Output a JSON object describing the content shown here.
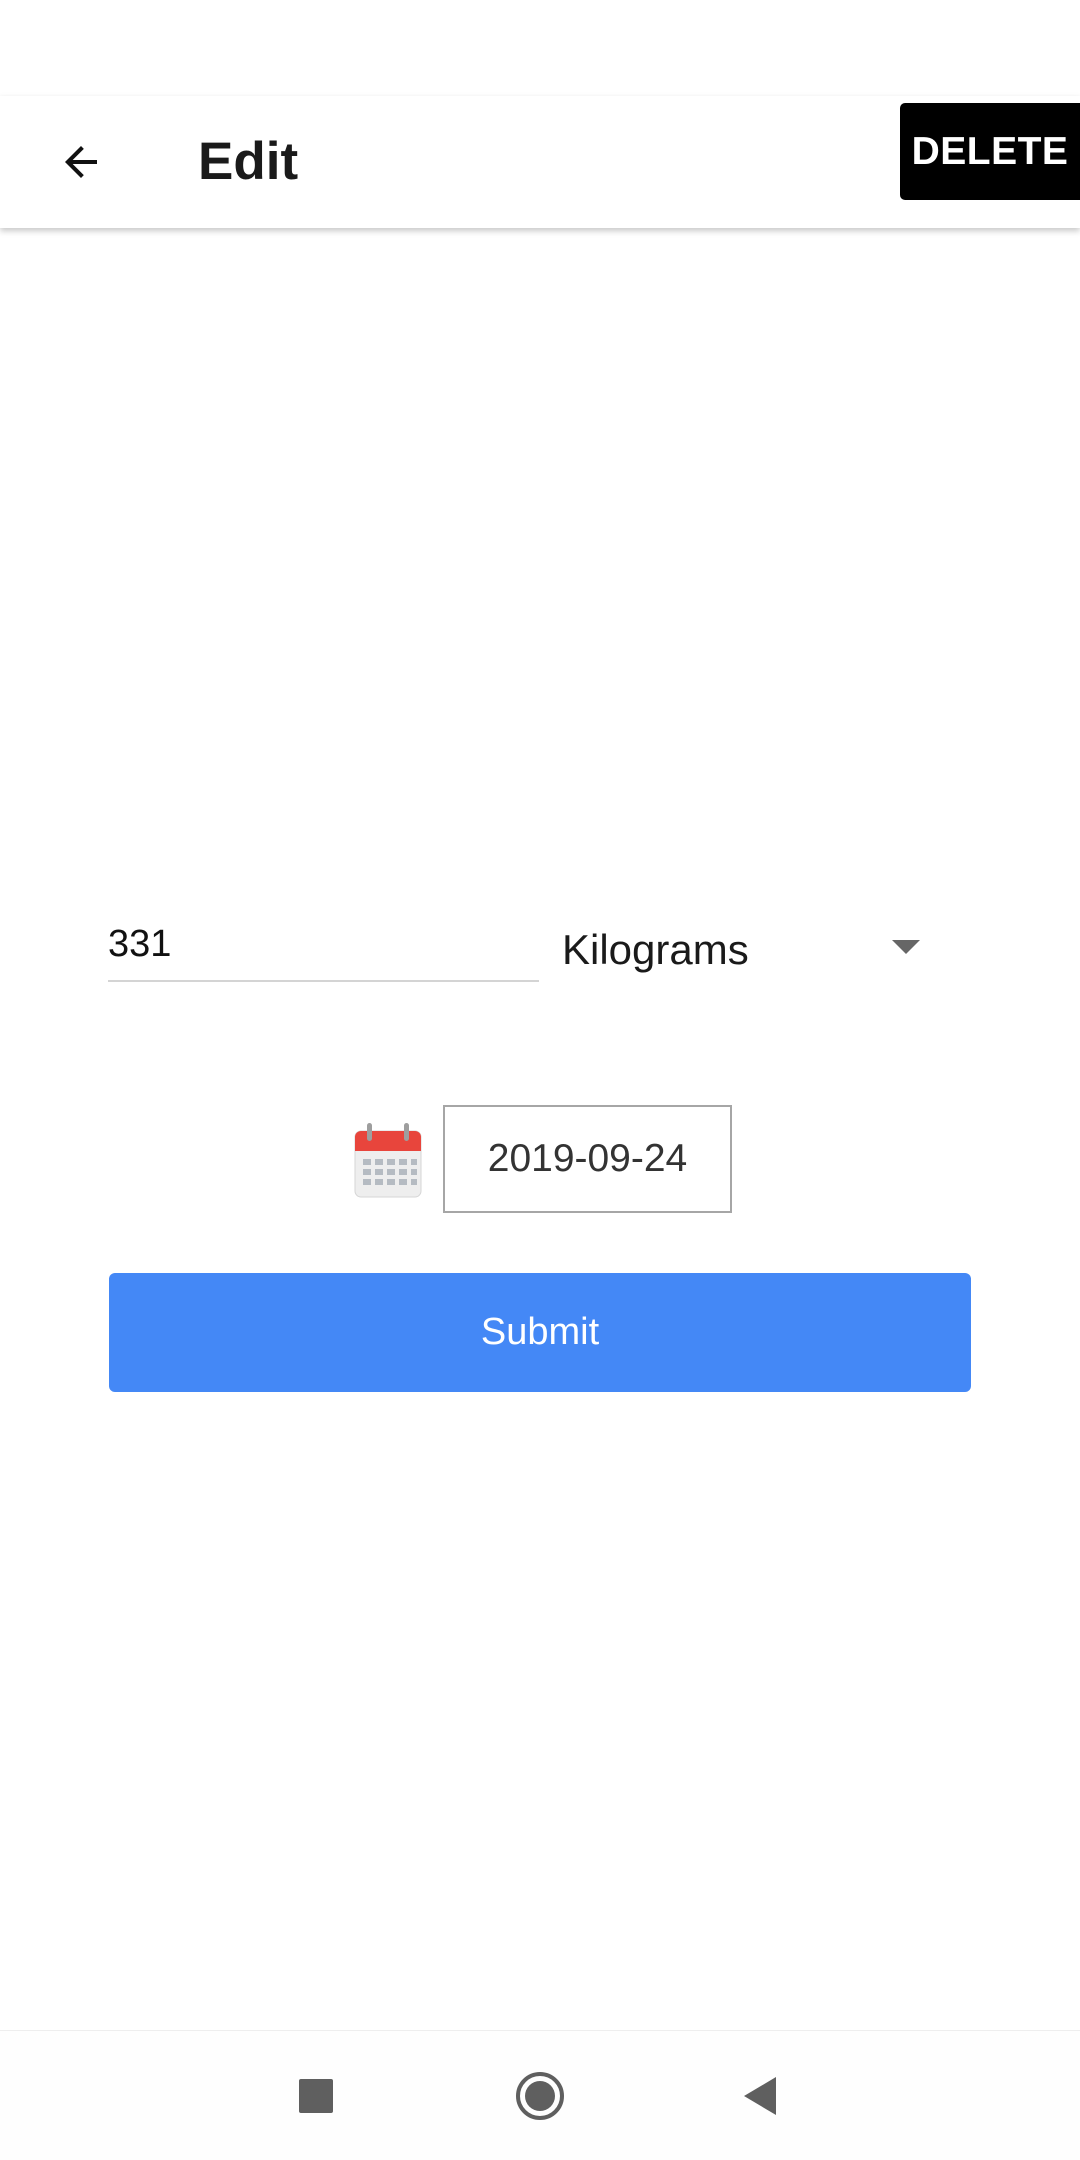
{
  "header": {
    "title": "Edit",
    "delete_label": "DELETE",
    "back_icon": "arrow-back-icon"
  },
  "form": {
    "value": "331",
    "unit_selected": "Kilograms",
    "unit_icon": "dropdown-arrow-icon",
    "date": "2019-09-24",
    "calendar_icon": "calendar-icon",
    "submit_label": "Submit"
  },
  "colors": {
    "submit_bg": "#4488f6",
    "delete_bg": "#000000",
    "calendar_red": "#e8453c"
  },
  "navigation": {
    "recents_icon": "square-icon",
    "home_icon": "circle-icon",
    "back_icon": "triangle-back-icon"
  }
}
